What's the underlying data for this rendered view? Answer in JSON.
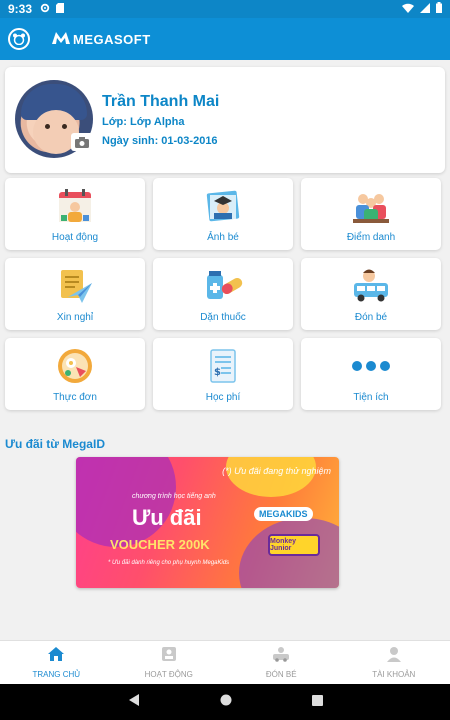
{
  "status_bar": {
    "time": "9:33"
  },
  "app_bar": {
    "brand_text": "MEGASOFT"
  },
  "profile": {
    "name": "Trần Thanh Mai",
    "class_label": "Lớp: Lớp Alpha",
    "dob_label": "Ngày sinh: 01-03-2016"
  },
  "menu": [
    {
      "label": "Hoạt động",
      "icon": "calendar-activity-icon"
    },
    {
      "label": "Ảnh bé",
      "icon": "graduation-photo-icon"
    },
    {
      "label": "Điểm danh",
      "icon": "attendance-people-icon"
    },
    {
      "label": "Xin nghỉ",
      "icon": "leave-request-paper-plane-icon"
    },
    {
      "label": "Dặn thuốc",
      "icon": "medicine-icon"
    },
    {
      "label": "Đón bé",
      "icon": "pickup-bus-icon"
    },
    {
      "label": "Thực đơn",
      "icon": "food-menu-icon"
    },
    {
      "label": "Học phí",
      "icon": "tuition-invoice-icon"
    },
    {
      "label": "Tiện ích",
      "icon": "more-dots-icon"
    }
  ],
  "promo": {
    "section_title": "Ưu đãi từ MegaID",
    "banner_top": "(*) Ưu đãi đang thử nghiệm",
    "banner_subtitle": "chương trình học tiếng anh",
    "banner_title": "Ưu đãi",
    "banner_voucher": "VOUCHER 200K",
    "banner_note": "* Ưu đãi dành riêng cho phụ huynh MegaKids",
    "banner_brand": "MEGAKIDS",
    "banner_product": "Monkey Junior"
  },
  "bottom_nav": [
    {
      "label": "TRANG CHỦ",
      "active": true
    },
    {
      "label": "HOẠT ĐỘNG",
      "active": false
    },
    {
      "label": "ĐÓN BÉ",
      "active": false
    },
    {
      "label": "TÀI KHOẢN",
      "active": false
    }
  ],
  "colors": {
    "primary": "#0d8fd6",
    "text_blue": "#1b8ad0",
    "background": "#f1f1f1"
  }
}
